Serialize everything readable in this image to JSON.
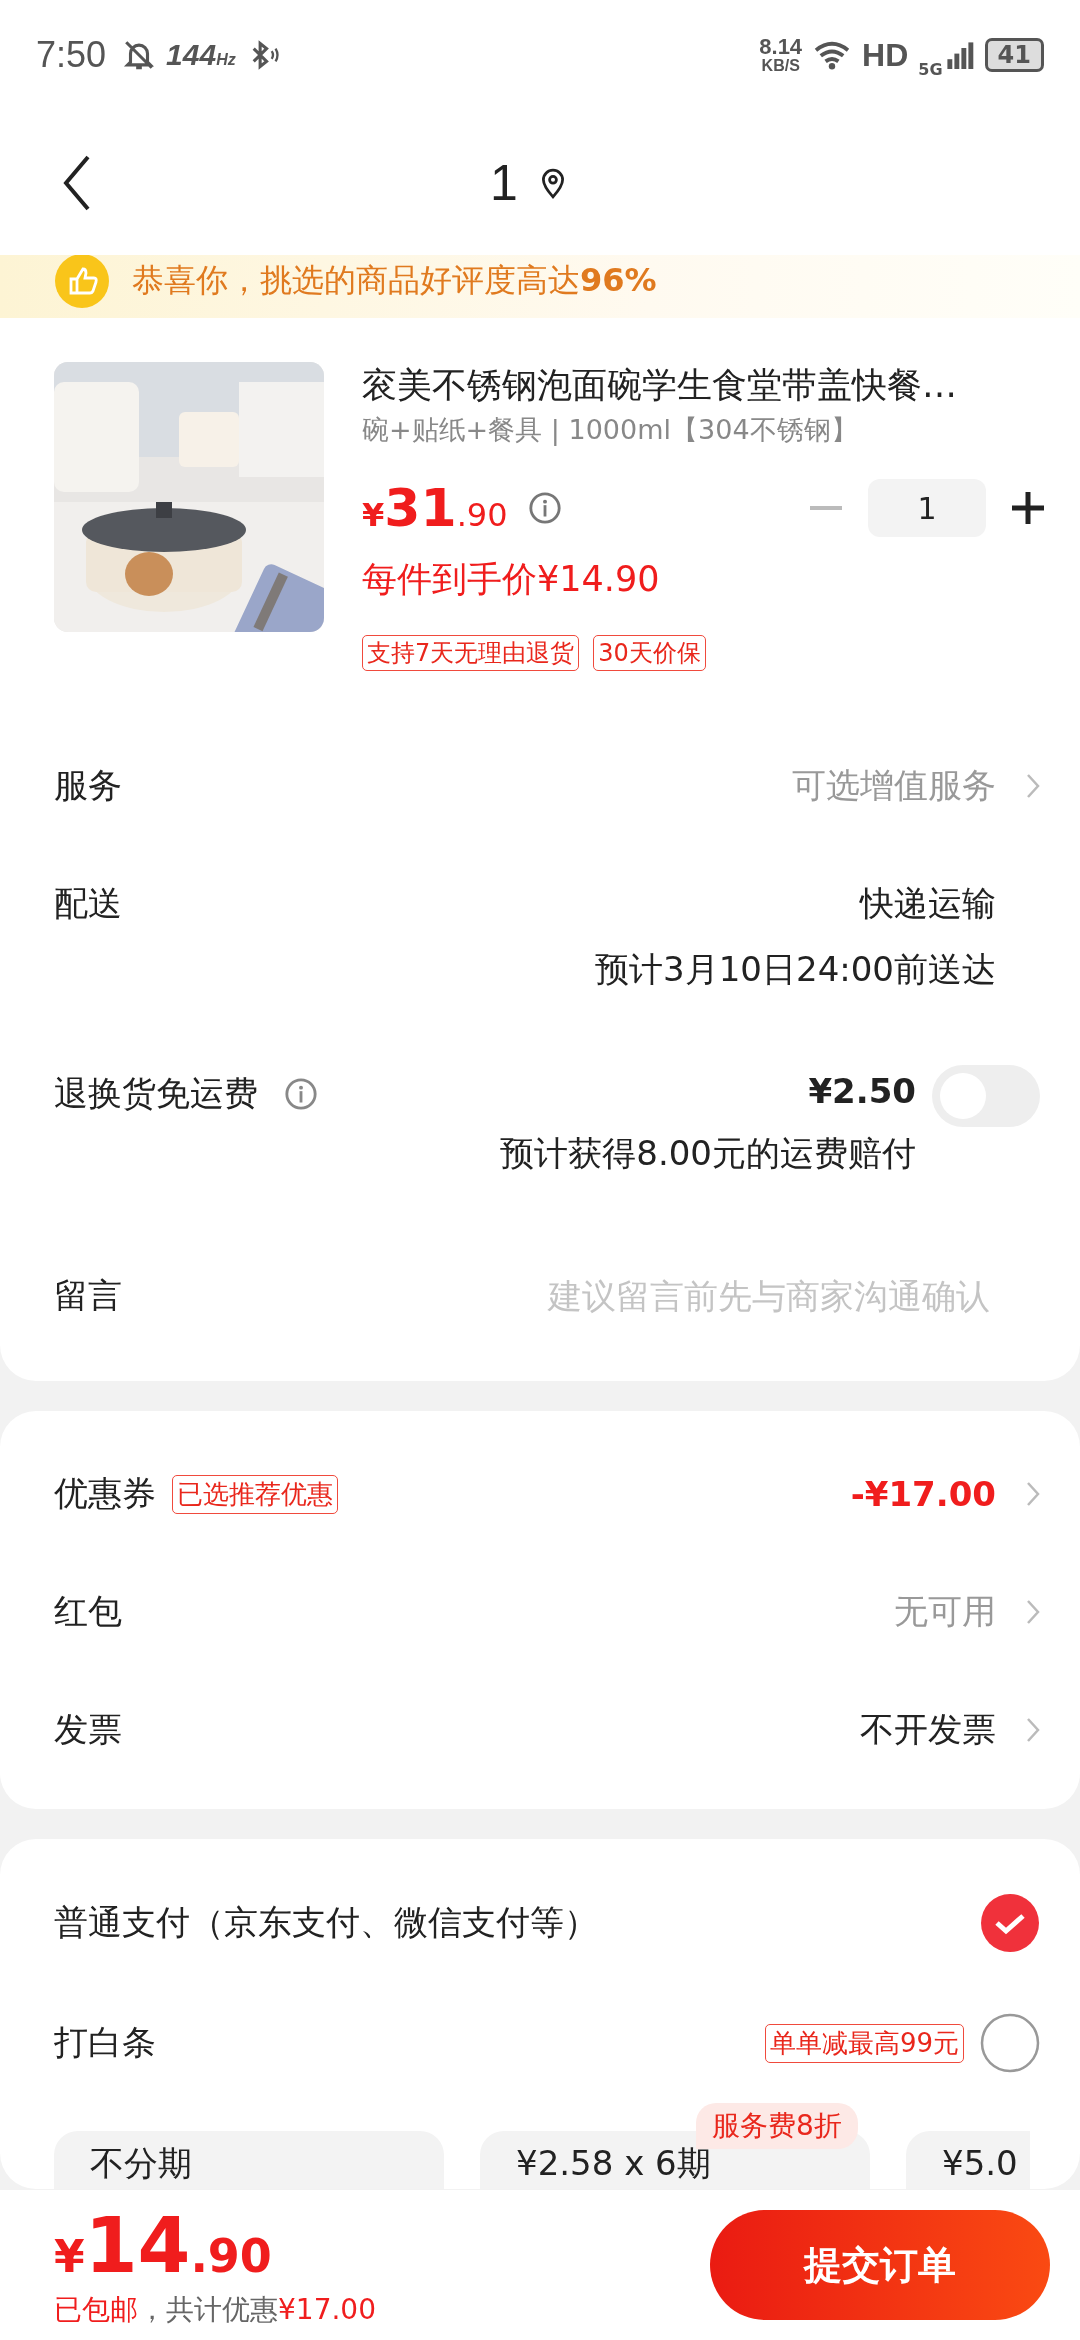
{
  "status_bar": {
    "time": "7:50",
    "refresh_rate": "144",
    "refresh_unit": "Hz",
    "net_speed": "8.14",
    "net_unit": "KB/S",
    "hd": "HD",
    "network": "5G",
    "battery": "41"
  },
  "nav": {
    "title": "1"
  },
  "banner": {
    "text": "恭喜你，挑选的商品好评度高达**96%**"
  },
  "product": {
    "title": "衮美不锈钢泡面碗学生食堂带盖快餐…",
    "spec": "碗+贴纸+餐具 | 1000ml【304不锈钢】",
    "currency": "¥",
    "price_int": "31",
    "price_dec": ".90",
    "final_price": "每件到手价¥14.90",
    "quantity": "1",
    "tags": [
      "支持7天无理由退货",
      "30天价保"
    ]
  },
  "order_rows": [
    {
      "kind": "link",
      "label": "服务",
      "value": "可选增值服务"
    },
    {
      "kind": "delivery",
      "label": "配送",
      "value": "快递运输",
      "note": "预计3月10日24:00前送达"
    },
    {
      "kind": "toggle",
      "label": "退换货免运费",
      "value": "¥2.50",
      "note": "预计获得8.00元的运费赔付",
      "on": false
    },
    {
      "kind": "input",
      "label": "留言",
      "placeholder": "建议留言前先与商家沟通确认"
    }
  ],
  "discount_rows": [
    {
      "label": "优惠券",
      "badge": "已选推荐优惠",
      "value": "-¥17.00",
      "kind": "discount"
    },
    {
      "label": "红包",
      "value": "无可用",
      "kind": "unavailable"
    },
    {
      "label": "发票",
      "value": "不开发票",
      "kind": "setting"
    }
  ],
  "payment": {
    "options": [
      {
        "label": "普通支付（京东支付、微信支付等）",
        "selected": true
      },
      {
        "label": "打白条",
        "badge": "单单减最高99元",
        "selected": false
      }
    ],
    "promo": "服务费8折",
    "installments": [
      "不分期",
      "¥2.58 x 6期",
      "¥5.0"
    ]
  },
  "footer": {
    "currency": "¥",
    "total_int": "14",
    "total_dec": ".90",
    "note": "已包邮，共计优惠",
    "note_amount": "¥17.00",
    "submit": "提交订单"
  }
}
